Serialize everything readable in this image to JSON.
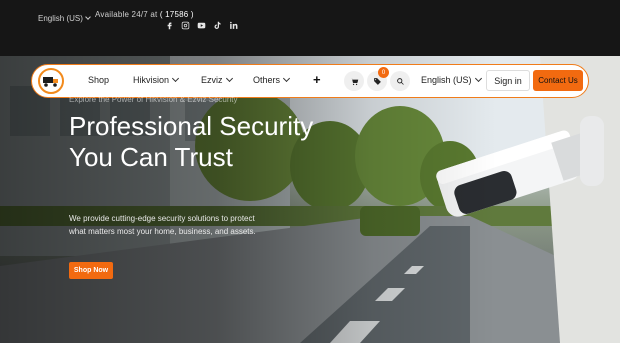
{
  "topbar": {
    "language": "English (US)",
    "availability_prefix": "Available 24/7 at",
    "phone": "( 17586 )",
    "socials": [
      "facebook-icon",
      "instagram-icon",
      "youtube-icon",
      "tiktok-icon",
      "linkedin-icon"
    ]
  },
  "nav": {
    "items": [
      {
        "label": "Shop"
      },
      {
        "label": "Hikvision"
      },
      {
        "label": "Ezviz"
      },
      {
        "label": "Others"
      }
    ],
    "plus": "+",
    "wishlist_count": "0",
    "language": "English (US)",
    "signin_label": "Sign in",
    "contact_label": "Contact Us"
  },
  "hero": {
    "eyebrow": "Explore the Power of Hikvision & Ezviz Security",
    "title": "Professional Security You Can Trust",
    "description": "We provide cutting-edge security solutions to protect what matters most your home, business, and assets.",
    "cta_label": "Shop Now"
  },
  "colors": {
    "accent": "#f26a10",
    "topbar_bg": "#161616"
  }
}
